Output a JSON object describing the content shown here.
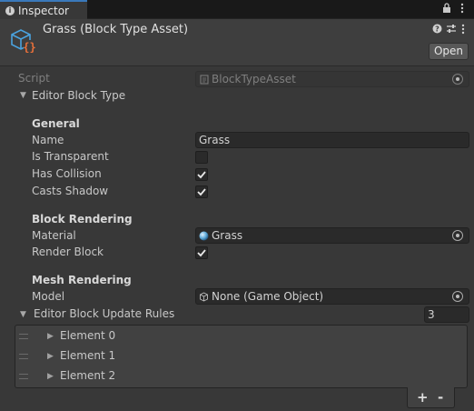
{
  "tab": {
    "title": "Inspector"
  },
  "header": {
    "asset_title": "Grass (Block Type Asset)",
    "open_label": "Open"
  },
  "script_row": {
    "label": "Script",
    "value": "BlockTypeAsset"
  },
  "editor_block_type": {
    "label": "Editor Block Type"
  },
  "general": {
    "title": "General",
    "name_label": "Name",
    "name_value": "Grass",
    "transparent_label": "Is Transparent",
    "transparent_checked": false,
    "collision_label": "Has Collision",
    "collision_checked": true,
    "shadow_label": "Casts Shadow",
    "shadow_checked": true
  },
  "block_rendering": {
    "title": "Block Rendering",
    "material_label": "Material",
    "material_value": "Grass",
    "render_label": "Render Block",
    "render_checked": true
  },
  "mesh_rendering": {
    "title": "Mesh Rendering",
    "model_label": "Model",
    "model_value": "None (Game Object)"
  },
  "update_rules": {
    "label": "Editor Block Update Rules",
    "count": "3",
    "elements": [
      "Element 0",
      "Element 1",
      "Element 2"
    ],
    "add_label": "+",
    "remove_label": "-"
  },
  "colors": {
    "accent": "#3a79bb",
    "asset_icon": "#4aa3df",
    "asset_braces": "#e8703a"
  },
  "icons": {
    "tab": "info-icon",
    "lock": "lock-icon",
    "menu": "more-icon",
    "help": "help-icon",
    "settings": "settings-icon",
    "script": "script-icon",
    "material": "material-icon",
    "model": "gameobject-icon"
  }
}
